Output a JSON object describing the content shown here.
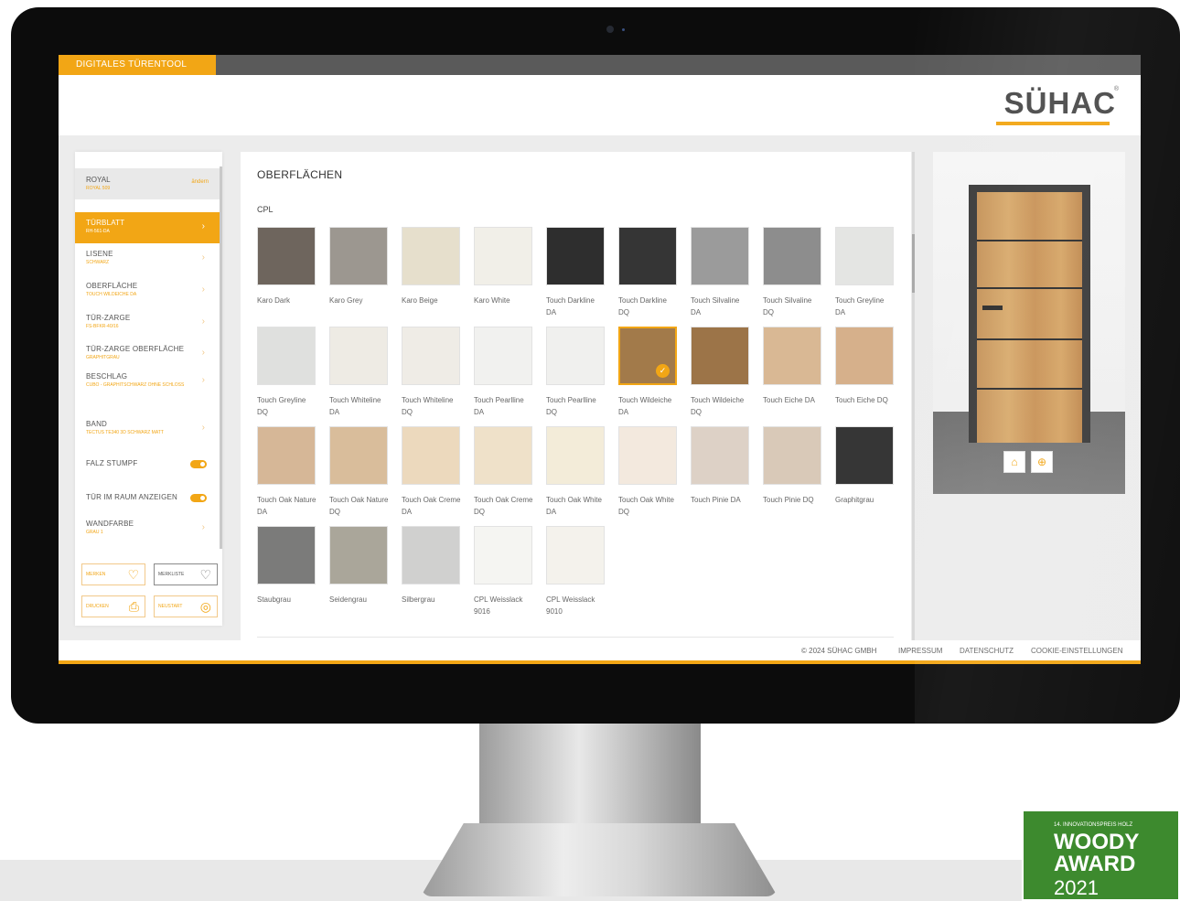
{
  "app": {
    "tool_name": "DIGITALES TÜRENTOOL",
    "logo": "SÜHAC",
    "logo_mark": "®"
  },
  "sidebar": {
    "model": {
      "title": "ROYAL",
      "subtitle": "ROYAL 509",
      "action": "ändern"
    },
    "items": [
      {
        "label": "TÜRBLATT",
        "sub": "RH-561-DA",
        "active": true
      },
      {
        "label": "LISENE",
        "sub": "SCHWARZ"
      },
      {
        "label": "OBERFLÄCHE",
        "sub": "TOUCH WILDEICHE DA"
      },
      {
        "label": "TÜR-ZARGE",
        "sub": "FS-BFKR-40/16"
      },
      {
        "label": "TÜR-ZARGE OBERFLÄCHE",
        "sub": "GRAPHITGRAU"
      },
      {
        "label": "BESCHLAG",
        "sub": "CUBO - GRAPHITSCHWARZ OHNE SCHLOSS"
      },
      {
        "label": "BAND",
        "sub": "TECTUS TE340 3D SCHWARZ MATT"
      }
    ],
    "toggles": [
      {
        "label": "FALZ STUMPF",
        "on": true
      },
      {
        "label": "TÜR IM RAUM ANZEIGEN",
        "on": true
      }
    ],
    "wall": {
      "label": "WANDFARBE",
      "sub": "GRAU 1"
    },
    "buttons": {
      "merken": "MERKEN",
      "merkliste": "MERKLISTE",
      "drucken": "DRUCKEN",
      "neustart": "NEUSTART"
    }
  },
  "main": {
    "title": "OBERFLÄCHEN",
    "group": "CPL",
    "swatches": [
      {
        "label": "Karo Dark",
        "color": "#6e655d"
      },
      {
        "label": "Karo Grey",
        "color": "#9c9790"
      },
      {
        "label": "Karo Beige",
        "color": "#e6dfcc"
      },
      {
        "label": "Karo White",
        "color": "#f1efe8"
      },
      {
        "label": "Touch Darkline DA",
        "color": "#2e2e2e"
      },
      {
        "label": "Touch Darkline DQ",
        "color": "#353535"
      },
      {
        "label": "Touch Silvaline DA",
        "color": "#9b9b9b"
      },
      {
        "label": "Touch Silvaline DQ",
        "color": "#8d8d8d"
      },
      {
        "label": "Touch Greyline DA",
        "color": "#e4e5e3"
      },
      {
        "label": "Touch Greyline DQ",
        "color": "#dfe0de"
      },
      {
        "label": "Touch Whiteline DA",
        "color": "#eeebe4"
      },
      {
        "label": "Touch Whiteline DQ",
        "color": "#efece6"
      },
      {
        "label": "Touch Pearlline DA",
        "color": "#f1f1ef"
      },
      {
        "label": "Touch Pearlline DQ",
        "color": "#f0f0ee"
      },
      {
        "label": "Touch Wildeiche DA",
        "color": "#a27a4a",
        "selected": true
      },
      {
        "label": "Touch Wildeiche DQ",
        "color": "#9c7448"
      },
      {
        "label": "Touch Eiche DA",
        "color": "#d9b894"
      },
      {
        "label": "Touch Eiche DQ",
        "color": "#d6b08b"
      },
      {
        "label": "Touch Oak Nature DA",
        "color": "#d6b797"
      },
      {
        "label": "Touch Oak Nature DQ",
        "color": "#d9bd9b"
      },
      {
        "label": "Touch Oak Creme DA",
        "color": "#ecd9bd"
      },
      {
        "label": "Touch Oak Creme DQ",
        "color": "#efe1c9"
      },
      {
        "label": "Touch Oak White DA",
        "color": "#f3ecd9"
      },
      {
        "label": "Touch Oak White DQ",
        "color": "#f3e9de"
      },
      {
        "label": "Touch Pinie DA",
        "color": "#ddd1c6"
      },
      {
        "label": "Touch Pinie DQ",
        "color": "#d9c9b8"
      },
      {
        "label": "Graphitgrau",
        "color": "#363636"
      },
      {
        "label": "Staubgrau",
        "color": "#7b7b7a"
      },
      {
        "label": "Seidengrau",
        "color": "#aaa69a"
      },
      {
        "label": "Silbergrau",
        "color": "#d0d0cf"
      },
      {
        "label": "CPL Weisslack 9016",
        "color": "#f5f5f2"
      },
      {
        "label": "CPL Weisslack 9010",
        "color": "#f4f2ec"
      }
    ]
  },
  "preview": {
    "btn_left_icon": "3d-view-icon",
    "btn_right_icon": "zoom-in-icon"
  },
  "footer": {
    "copyright": "© 2024 SÜHAC GMBH",
    "impressum": "IMPRESSUM",
    "datenschutz": "DATENSCHUTZ",
    "cookies": "COOKIE-EINSTELLUNGEN"
  },
  "award": {
    "line1": "14. INNOVATIONSPREIS HOLZ",
    "line2": "WOODY",
    "line3": "AWARD",
    "line4": "2021"
  },
  "colors": {
    "accent": "#f2a615",
    "award_green": "#3d8a2e"
  }
}
